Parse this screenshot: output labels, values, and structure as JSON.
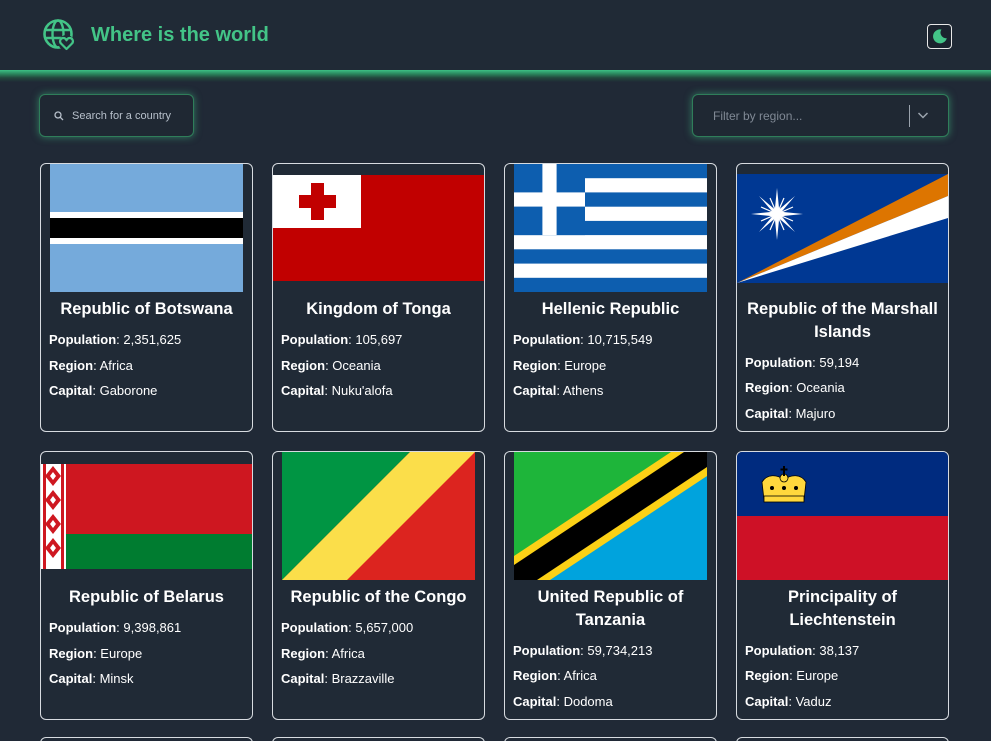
{
  "header": {
    "title": "Where is the world",
    "logo_icon": "globe-heart-icon",
    "theme_icon": "moon-icon",
    "accent": "#43c487"
  },
  "search": {
    "placeholder": "Search for a country",
    "value": ""
  },
  "filter": {
    "placeholder": "Filter by region..."
  },
  "labels": {
    "population": "Population",
    "region": "Region",
    "capital": "Capital"
  },
  "countries": [
    {
      "name": "Republic of Botswana",
      "population": "2,351,625",
      "region": "Africa",
      "capital": "Gaborone",
      "flag": "botswana-flag"
    },
    {
      "name": "Kingdom of Tonga",
      "population": "105,697",
      "region": "Oceania",
      "capital": "Nuku'alofa",
      "flag": "tonga-flag"
    },
    {
      "name": "Hellenic Republic",
      "population": "10,715,549",
      "region": "Europe",
      "capital": "Athens",
      "flag": "greece-flag"
    },
    {
      "name": "Republic of the Marshall Islands",
      "population": "59,194",
      "region": "Oceania",
      "capital": "Majuro",
      "flag": "marshall-islands-flag"
    },
    {
      "name": "Republic of Belarus",
      "population": "9,398,861",
      "region": "Europe",
      "capital": "Minsk",
      "flag": "belarus-flag"
    },
    {
      "name": "Republic of the Congo",
      "population": "5,657,000",
      "region": "Africa",
      "capital": "Brazzaville",
      "flag": "congo-flag"
    },
    {
      "name": "United Republic of Tanzania",
      "population": "59,734,213",
      "region": "Africa",
      "capital": "Dodoma",
      "flag": "tanzania-flag"
    },
    {
      "name": "Principality of Liechtenstein",
      "population": "38,137",
      "region": "Europe",
      "capital": "Vaduz",
      "flag": "liechtenstein-flag"
    }
  ]
}
